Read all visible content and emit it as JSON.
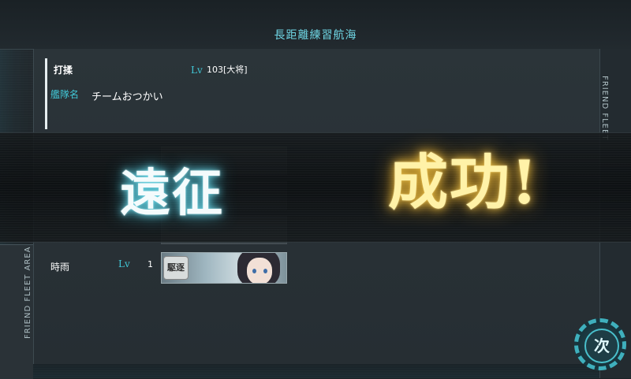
{
  "header": {
    "title": "長距離練習航海"
  },
  "side_tabs": {
    "left": "FRIEND FLEET AREA",
    "right": "FRIEND FLEET"
  },
  "admiral": {
    "name": "打揉",
    "lv_label": "Lv",
    "level": "103[大将]"
  },
  "fleet": {
    "label": "艦隊名",
    "name": "チームおつかい"
  },
  "ships": [
    {
      "name": "時雨",
      "lv_label": "Lv",
      "level": "1",
      "type_badge": "駆逐"
    }
  ],
  "result_banner": {
    "left": "遠征",
    "right": "成功!"
  },
  "next_button": {
    "label": "次",
    "icon": "gear-icon"
  },
  "colors": {
    "accent": "#41c7d6",
    "success_gold": "#f2c444",
    "panel": "#2b3439"
  }
}
